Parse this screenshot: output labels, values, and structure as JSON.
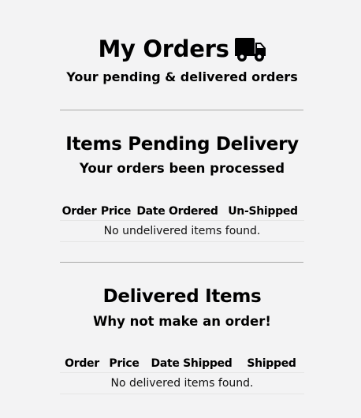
{
  "header": {
    "title": "My Orders",
    "truck_icon": "truck-icon",
    "subtitle": "Your pending & delivered orders"
  },
  "pending": {
    "title": "Items Pending Delivery",
    "subtitle": "Your orders been processed",
    "columns": [
      "Order",
      "Price",
      "Date Ordered",
      "Un-Shipped"
    ],
    "empty_message": "No undelivered items found."
  },
  "delivered": {
    "title": "Delivered Items",
    "subtitle": "Why not make an order!",
    "columns": [
      "Order",
      "Price",
      "Date Shipped",
      "Shipped"
    ],
    "empty_message": "No delivered items found."
  },
  "colors": {
    "background": "#f3f3f4",
    "divider": "#a8a8a8",
    "text": "#000000"
  }
}
